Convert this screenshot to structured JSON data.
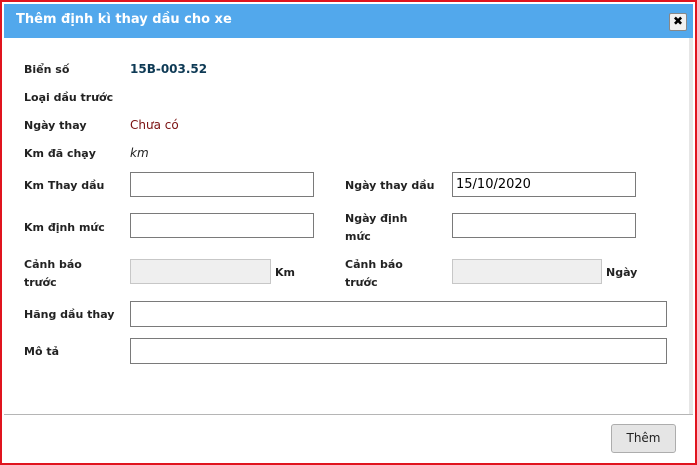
{
  "dialog": {
    "title": "Thêm định kì thay dầu cho xe",
    "close_glyph": "✖"
  },
  "fields": {
    "bien_so": {
      "label": "Biển số",
      "value": "15B-003.52"
    },
    "loai_dau": {
      "label": "Loại dầu trước"
    },
    "ngay_thay": {
      "label": "Ngày thay",
      "value": "Chưa có"
    },
    "km_da_chay": {
      "label": "Km đã chạy",
      "value": "km"
    },
    "km_thay_dau": {
      "label": "Km Thay dầu",
      "value": ""
    },
    "ngay_thay_dau": {
      "label": "Ngày thay dầu",
      "value": "15/10/2020"
    },
    "km_dinh_muc": {
      "label": "Km định mức",
      "value": ""
    },
    "ngay_dinh_muc": {
      "label_line1": "Ngày định",
      "label_line2": "mức",
      "value": ""
    },
    "canh_bao_km": {
      "label_line1": "Cảnh báo",
      "label_line2": "trước",
      "value": "",
      "unit": "Km"
    },
    "canh_bao_ngay": {
      "label_line1": "Cảnh báo",
      "label_line2": "trước",
      "value": "",
      "unit": "Ngày"
    },
    "hang_dau": {
      "label": "Hãng dầu thay",
      "value": ""
    },
    "mo_ta": {
      "label": "Mô tả",
      "value": ""
    }
  },
  "footer": {
    "submit_label": "Thêm"
  },
  "colors": {
    "titlebar": "#52a8ec",
    "border": "#e0141e",
    "plate_text": "#0e3a55",
    "status_text": "#7a1010"
  }
}
